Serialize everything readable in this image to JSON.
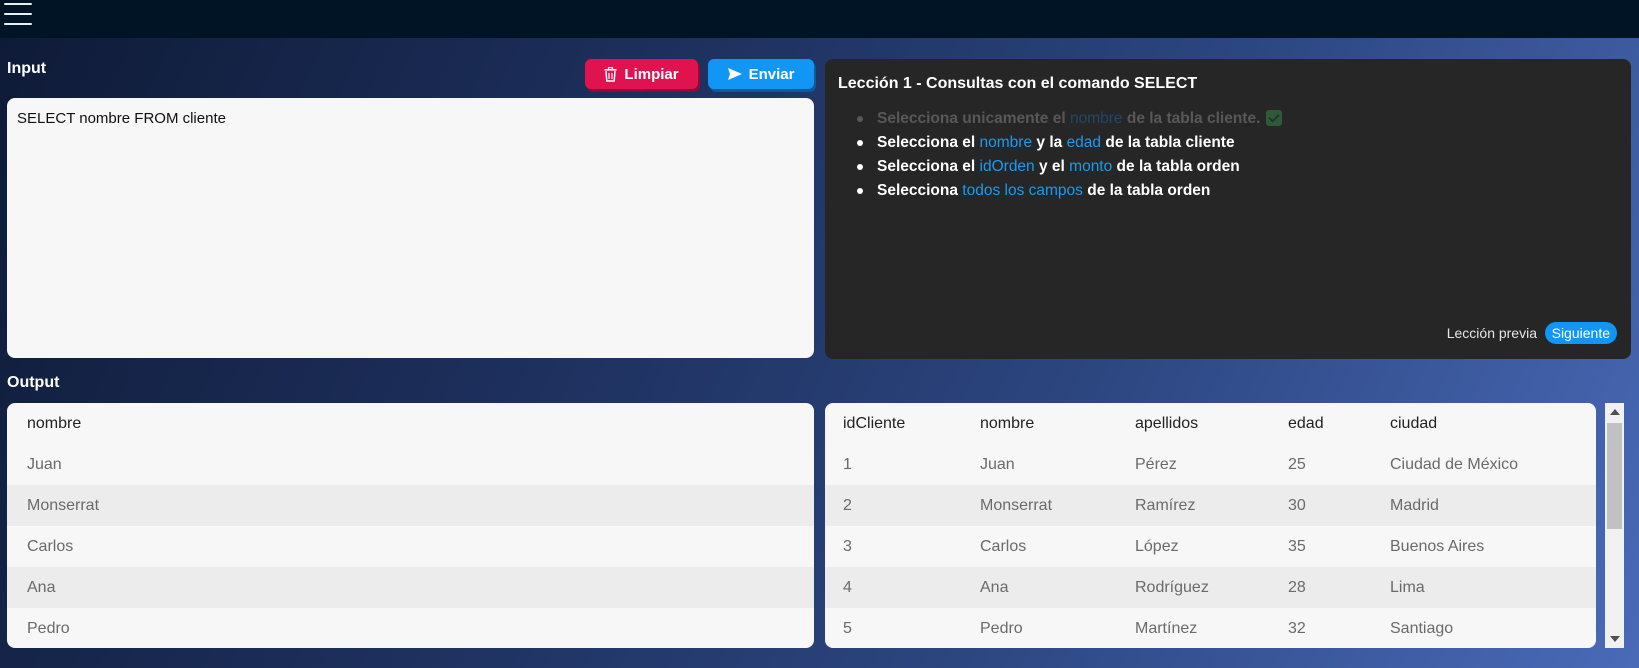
{
  "topbar": {
    "menu_icon": "hamburger-menu-icon"
  },
  "input": {
    "label": "Input",
    "query": "SELECT nombre FROM cliente",
    "clear_button": {
      "label": "Limpiar",
      "icon": "trash-icon",
      "color": "#e0124f"
    },
    "send_button": {
      "label": "Enviar",
      "icon": "send-icon",
      "color": "#1296f5"
    }
  },
  "lesson": {
    "title": "Lección 1 - Consultas con el comando SELECT",
    "tasks": [
      {
        "done": true,
        "parts": [
          "Selecciona unicamente el ",
          "nombre",
          " de la tabla cliente."
        ]
      },
      {
        "done": false,
        "parts": [
          "Selecciona el ",
          "nombre",
          " y la ",
          "edad",
          " de la tabla cliente"
        ]
      },
      {
        "done": false,
        "parts": [
          "Selecciona el ",
          "idOrden",
          " y el ",
          "monto",
          " de la tabla orden"
        ]
      },
      {
        "done": false,
        "parts": [
          "Selecciona ",
          "todos los campos",
          " de la tabla orden"
        ]
      }
    ],
    "prev_label": "Lección previa",
    "next_label": "Siguiente"
  },
  "output": {
    "label": "Output",
    "result": {
      "columns": [
        "nombre"
      ],
      "rows": [
        [
          "Juan"
        ],
        [
          "Monserrat"
        ],
        [
          "Carlos"
        ],
        [
          "Ana"
        ],
        [
          "Pedro"
        ]
      ]
    },
    "table": {
      "columns": [
        "idCliente",
        "nombre",
        "apellidos",
        "edad",
        "ciudad"
      ],
      "rows": [
        [
          "1",
          "Juan",
          "Pérez",
          "25",
          "Ciudad de México"
        ],
        [
          "2",
          "Monserrat",
          "Ramírez",
          "30",
          "Madrid"
        ],
        [
          "3",
          "Carlos",
          "López",
          "35",
          "Buenos Aires"
        ],
        [
          "4",
          "Ana",
          "Rodríguez",
          "28",
          "Lima"
        ],
        [
          "5",
          "Pedro",
          "Martínez",
          "32",
          "Santiago"
        ]
      ]
    }
  }
}
